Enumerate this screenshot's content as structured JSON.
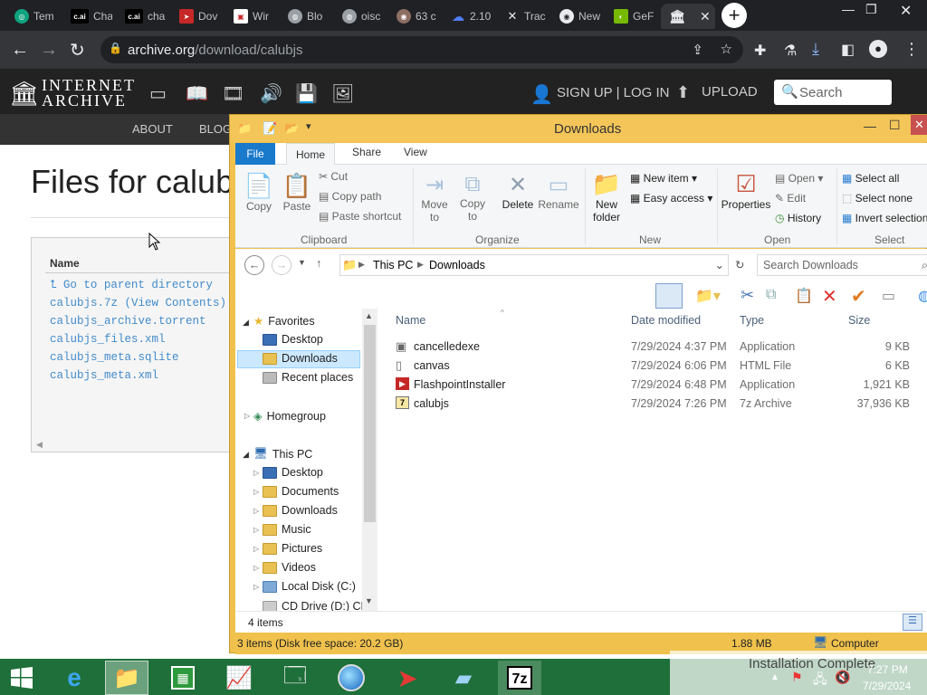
{
  "browser": {
    "tabs": [
      {
        "label": "Tem",
        "icon": "chatgpt-icon"
      },
      {
        "label": "Cha",
        "icon": "character-ai-icon"
      },
      {
        "label": "cha",
        "icon": "character-ai-icon"
      },
      {
        "label": "Dov",
        "icon": "download-site-icon"
      },
      {
        "label": "Wir",
        "icon": "web-page-icon"
      },
      {
        "label": "Blo",
        "icon": "globe-icon"
      },
      {
        "label": "oisc",
        "icon": "globe-icon"
      },
      {
        "label": "63 c",
        "icon": "game-icon"
      },
      {
        "label": "2.10",
        "icon": "cloud-icon"
      },
      {
        "label": "Trac",
        "icon": "x-icon"
      },
      {
        "label": "New",
        "icon": "chrome-icon"
      },
      {
        "label": "GeF",
        "icon": "nvidia-icon"
      },
      {
        "label": "",
        "icon": "internet-archive-icon"
      }
    ],
    "url_host": "archive.org",
    "url_path": "/download/calubjs"
  },
  "archive": {
    "logo_line1": "INTERNET",
    "logo_line2": "ARCHIVE",
    "signup": "SIGN UP | LOG IN",
    "upload": "UPLOAD",
    "search_placeholder": "Search",
    "nav": [
      "ABOUT",
      "BLOG"
    ],
    "page_title": "Files for calub",
    "table_header": "Name",
    "files": [
      "Go to parent directory",
      "calubjs.7z (View Contents)",
      "calubjs_archive.torrent",
      "calubjs_files.xml",
      "calubjs_meta.sqlite",
      "calubjs_meta.xml"
    ]
  },
  "explorer": {
    "title": "Downloads",
    "ribbon_tabs": [
      "File",
      "Home",
      "Share",
      "View"
    ],
    "clipboard": {
      "copy": "Copy",
      "paste": "Paste",
      "cut": "Cut",
      "copy_path": "Copy path",
      "paste_shortcut": "Paste shortcut",
      "group": "Clipboard"
    },
    "organize": {
      "move_to": "Move to",
      "copy_to": "Copy to",
      "delete": "Delete",
      "rename": "Rename",
      "group": "Organize"
    },
    "new": {
      "new_folder": "New folder",
      "new_item": "New item",
      "easy_access": "Easy access",
      "group": "New"
    },
    "open": {
      "properties": "Properties",
      "open": "Open",
      "edit": "Edit",
      "history": "History",
      "group": "Open"
    },
    "select": {
      "select_all": "Select all",
      "select_none": "Select none",
      "invert": "Invert selection",
      "group": "Select"
    },
    "breadcrumb": [
      "This PC",
      "Downloads"
    ],
    "search_placeholder": "Search Downloads",
    "nav_pane": {
      "favorites": "Favorites",
      "fav_items": [
        "Desktop",
        "Downloads",
        "Recent places"
      ],
      "homegroup": "Homegroup",
      "thispc": "This PC",
      "pc_items": [
        "Desktop",
        "Documents",
        "Downloads",
        "Music",
        "Pictures",
        "Videos",
        "Local Disk (C:)",
        "CD Drive (D:) CPI"
      ]
    },
    "columns": [
      "Name",
      "Date modified",
      "Type",
      "Size"
    ],
    "files": [
      {
        "name": "cancelledexe",
        "date": "7/29/2024 4:37 PM",
        "type": "Application",
        "size": "9 KB"
      },
      {
        "name": "canvas",
        "date": "7/29/2024 6:06 PM",
        "type": "HTML File",
        "size": "6 KB"
      },
      {
        "name": "FlashpointInstaller",
        "date": "7/29/2024 6:48 PM",
        "type": "Application",
        "size": "1,921 KB"
      },
      {
        "name": "calubjs",
        "date": "7/29/2024 7:26 PM",
        "type": "7z Archive",
        "size": "37,936 KB"
      }
    ],
    "item_count": "4 items",
    "status_left": "3 items (Disk free space: 20.2 GB)",
    "status_size": "1.88 MB",
    "status_location": "Computer"
  },
  "taskbar": {
    "toast": "Installation Complete",
    "time": "7:27 PM",
    "date": "7/29/2024"
  },
  "colors": {
    "taskbar": "#1e6f39",
    "explorer_frame": "#f0c24d",
    "chrome_dark": "#202124",
    "archive_header": "#222222"
  }
}
